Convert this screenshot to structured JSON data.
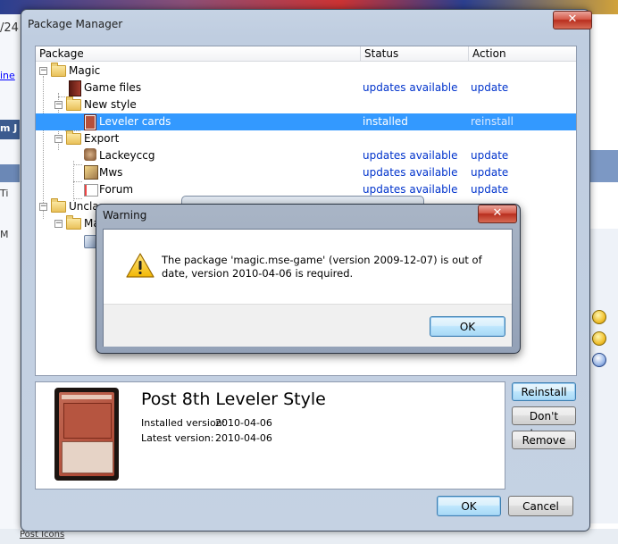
{
  "background": {
    "left_fragments": [
      "/24",
      "ine",
      "m J",
      "Ti",
      "M"
    ],
    "bottom_label": "Post Icons"
  },
  "package_manager": {
    "title": "Package Manager",
    "close_glyph": "✕",
    "columns": [
      "Package",
      "Status",
      "Action"
    ],
    "tree": [
      {
        "name": "Magic",
        "icon": "folder-icon",
        "toggle": "−",
        "status": "",
        "action": ""
      },
      {
        "name": "Game files",
        "icon": "book-icon",
        "status": "updates available",
        "action": "update"
      },
      {
        "name": "New style",
        "icon": "folder-icon",
        "toggle": "−",
        "status": "",
        "action": ""
      },
      {
        "name": "Leveler cards",
        "icon": "card-icon",
        "status": "installed",
        "action": "reinstall",
        "selected": true
      },
      {
        "name": "Export",
        "icon": "folder-icon",
        "toggle": "−",
        "status": "",
        "action": ""
      },
      {
        "name": "Lackeyccg",
        "icon": "lackey-icon",
        "status": "updates available",
        "action": "update"
      },
      {
        "name": "Mws",
        "icon": "mws-icon",
        "status": "updates available",
        "action": "update"
      },
      {
        "name": "Forum",
        "icon": "forum-icon",
        "status": "updates available",
        "action": "update"
      },
      {
        "name": "Unclas",
        "icon": "folder-icon",
        "toggle": "−",
        "status": "",
        "action": ""
      },
      {
        "name": "Ma",
        "icon": "folder-icon",
        "toggle": "−",
        "status": "",
        "action": ""
      },
      {
        "name": "",
        "icon": "package-icon",
        "status": "",
        "action": ""
      }
    ],
    "details": {
      "title": "Post 8th Leveler Style",
      "installed_label": "Installed version:",
      "installed_value": "2010-04-06",
      "latest_label": "Latest version:",
      "latest_value": "2010-04-06"
    },
    "buttons": {
      "reinstall": "Reinstall",
      "dont_change": "Don't change",
      "remove": "Remove",
      "ok": "OK",
      "cancel": "Cancel"
    }
  },
  "warning": {
    "title": "Warning",
    "close_glyph": "✕",
    "message": "The package 'magic.mse-game' (version 2009-12-07) is out of date, version 2010-04-06 is required.",
    "ok": "OK",
    "icon": "warning-triangle-icon"
  },
  "colors": {
    "selection": "#3399ff",
    "link_blue": "#0033cc",
    "close_red": "#c4382a"
  }
}
